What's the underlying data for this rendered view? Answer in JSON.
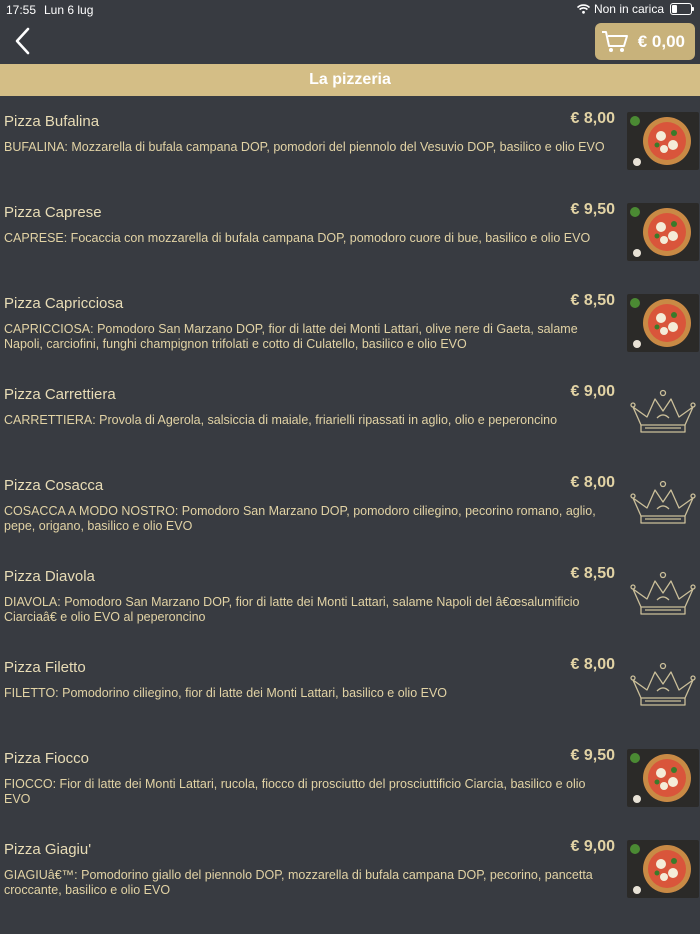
{
  "status": {
    "time": "17:55",
    "date": "Lun 6 lug",
    "network": "Non in carica",
    "battery_level": 0.3
  },
  "header": {
    "cart_total": "€ 0,00"
  },
  "section": {
    "title": "La pizzeria"
  },
  "items": [
    {
      "name": "Pizza Bufalina",
      "price": "€ 8,00",
      "desc": "BUFALINA: Mozzarella di bufala campana DOP, pomodori del piennolo del Vesuvio DOP, basilico e olio EVO",
      "image": "photo-pizza"
    },
    {
      "name": "Pizza Caprese",
      "price": "€ 9,50",
      "desc": "CAPRESE: Focaccia con mozzarella di bufala campana DOP, pomodoro cuore di bue, basilico e olio EVO",
      "image": "photo-pizza"
    },
    {
      "name": "Pizza Capricciosa",
      "price": "€ 8,50",
      "desc": "CAPRICCIOSA: Pomodoro San Marzano DOP, fior di latte dei Monti Lattari, olive nere di Gaeta, salame Napoli, carciofini, funghi champignon trifolati e cotto di Culatello, basilico e olio EVO",
      "image": "photo-pizza"
    },
    {
      "name": "Pizza Carrettiera",
      "price": "€ 9,00",
      "desc": "CARRETTIERA: Provola di Agerola, salsiccia di maiale, friarielli ripassati in aglio, olio e peperoncino",
      "image": "crown-logo"
    },
    {
      "name": "Pizza Cosacca",
      "price": "€ 8,00",
      "desc": "COSACCA A MODO NOSTRO: Pomodoro San Marzano DOP, pomodoro ciliegino, pecorino romano, aglio, pepe, origano, basilico e olio EVO",
      "image": "crown-logo"
    },
    {
      "name": "Pizza Diavola",
      "price": "€ 8,50",
      "desc": "DIAVOLA: Pomodoro San Marzano DOP, fior di latte dei Monti Lattari, salame Napoli del â€œsalumificio Ciarciaâ€ e olio EVO al peperoncino",
      "image": "crown-logo"
    },
    {
      "name": "Pizza Filetto",
      "price": "€ 8,00",
      "desc": "FILETTO: Pomodorino ciliegino, fior di latte dei Monti Lattari, basilico e olio EVO",
      "image": "crown-logo"
    },
    {
      "name": "Pizza Fiocco",
      "price": "€ 9,50",
      "desc": "FIOCCO: Fior di latte dei Monti Lattari, rucola, fiocco di prosciutto del prosciuttificio Ciarcia, basilico e olio EVO",
      "image": "photo-pizza"
    },
    {
      "name": "Pizza Giagiu'",
      "price": "€ 9,00",
      "desc": "GIAGIUâ€™: Pomodorino giallo del piennolo DOP, mozzarella di bufala campana DOP, pecorino, pancetta croccante, basilico e olio EVO",
      "image": "photo-pizza"
    }
  ]
}
